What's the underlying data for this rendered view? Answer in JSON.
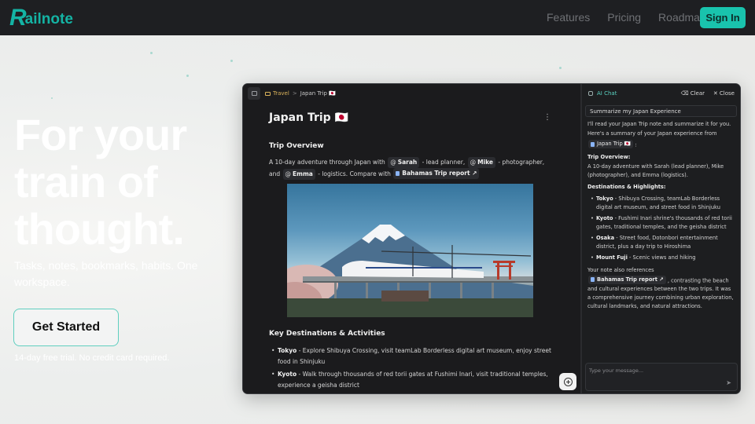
{
  "brand": {
    "logo_letter": "R",
    "logo_rest": "ailnote"
  },
  "nav": {
    "links": [
      "Features",
      "Pricing",
      "Roadmap"
    ],
    "signin": "Sign In"
  },
  "hero": {
    "title_lines": [
      "For your",
      "train of",
      "thought."
    ],
    "subtitle": "Tasks, notes, bookmarks, habits. One workspace.",
    "cta": "Get Started",
    "cta_note": "14-day free trial. No credit card required."
  },
  "editor": {
    "breadcrumb": {
      "folder": "Travel",
      "separator": ">",
      "page": "Japan Trip 🇯🇵"
    },
    "title": "Japan Trip 🇯🇵",
    "section1_heading": "Trip Overview",
    "overview": {
      "t1": "A 10-day adventure through Japan with",
      "m1": "Sarah",
      "t2": "- lead planner,",
      "m2": "Mike",
      "t3": "- photographer, and",
      "m3": "Emma",
      "t4": "- logistics. Compare with",
      "ref": "Bahamas Trip report ↗"
    },
    "section2_heading": "Key Destinations & Activities",
    "destinations": [
      {
        "name": "Tokyo",
        "text": " - Explore Shibuya Crossing, visit teamLab Borderless digital art museum, enjoy street food in Shinjuku"
      },
      {
        "name": "Kyoto",
        "text": " - Walk through thousands of red torii gates at Fushimi Inari, visit traditional temples, experience a geisha district"
      }
    ]
  },
  "chat": {
    "title": "AI Chat",
    "clear": "Clear",
    "close": "Close",
    "user_message": "Summarize my Japan Experience",
    "ai_intro": "I'll read your Japan Trip note and summarize it for you.",
    "ai_intro2": "Here's a summary of your Japan experience from",
    "ai_ref_chip": "Japan Trip 🇯🇵",
    "ai_ref_suffix": ":",
    "overview_label": "Trip Overview:",
    "overview_text": "A 10-day adventure with Sarah (lead planner), Mike (photographer), and Emma (logistics).",
    "highlights_label": "Destinations & Highlights:",
    "highlights": [
      {
        "name": "Tokyo",
        "text": " - Shibuya Crossing, teamLab Borderless digital art museum, and street food in Shinjuku"
      },
      {
        "name": "Kyoto",
        "text": " - Fushimi Inari shrine's thousands of red torii gates, traditional temples, and the geisha district"
      },
      {
        "name": "Osaka",
        "text": " - Street food, Dotonbori entertainment district, plus a day trip to Hiroshima"
      },
      {
        "name": "Mount Fuji",
        "text": " - Scenic views and hiking"
      }
    ],
    "closing_pre": "Your note also references",
    "closing_chip": "Bahamas Trip report ↗",
    "closing_post": ", contrasting the beach and cultural experiences between the two trips. It was a comprehensive journey combining urban exploration, cultural landmarks, and natural attractions.",
    "input_placeholder": "Type your message..."
  },
  "icons": {
    "sidebar_toggle": "sidebar-icon",
    "folder": "folder-icon",
    "more": "more-vertical-icon",
    "add": "plus-circle-icon",
    "chat": "chat-icon",
    "clear": "eraser-icon",
    "close": "close-icon",
    "send": "send-icon"
  },
  "colors": {
    "accent": "#19c3ad",
    "nav_bg": "#1e1f22",
    "app_bg": "#1a1a1c"
  }
}
